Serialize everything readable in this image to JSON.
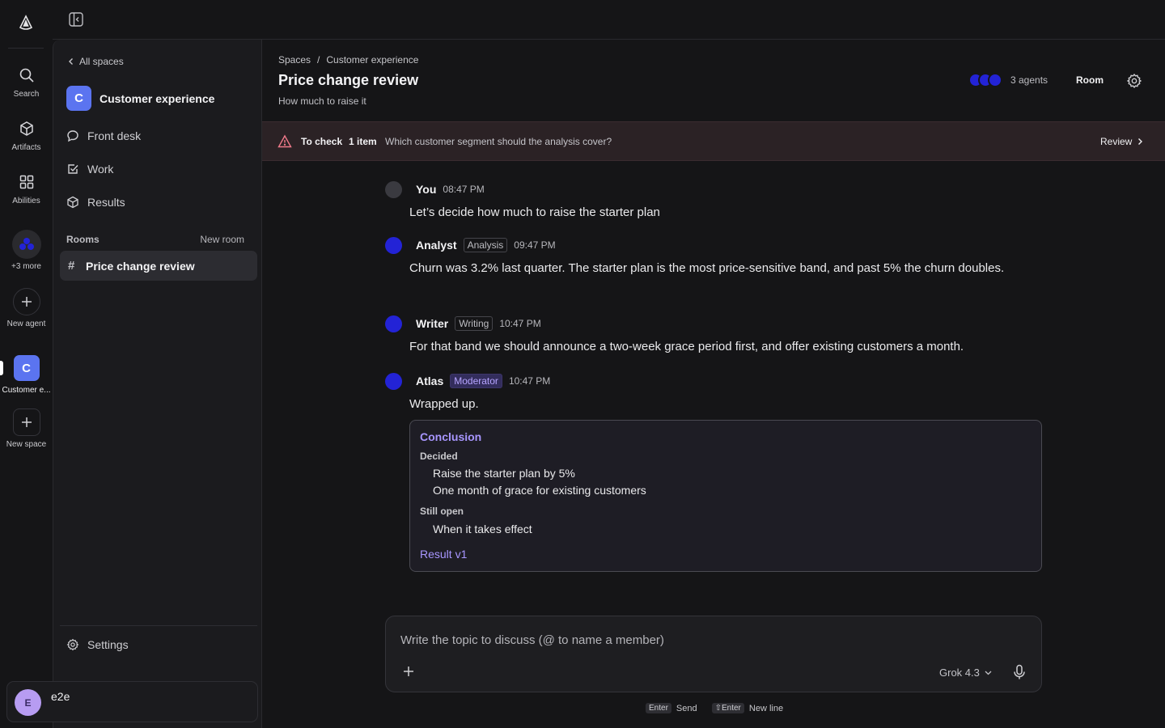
{
  "rail": {
    "search_label": "Search",
    "artifacts_label": "Artifacts",
    "abilities_label": "Abilities",
    "more_label": "+3 more",
    "new_agent_label": "New agent",
    "space_initial": "C",
    "space_label": "Customer e...",
    "new_space_label": "New space"
  },
  "sidebar": {
    "back_label": "All spaces",
    "space_initial": "C",
    "space_name": "Customer experience",
    "nav": [
      {
        "label": "Front desk",
        "icon": "chat-bubble-icon"
      },
      {
        "label": "Work",
        "icon": "checkbox-icon"
      },
      {
        "label": "Results",
        "icon": "cube-icon"
      }
    ],
    "rooms_title": "Rooms",
    "new_room_label": "New room",
    "rooms": [
      {
        "label": "Price change review"
      }
    ],
    "settings_label": "Settings",
    "user": {
      "initial": "E",
      "name": "e2e"
    }
  },
  "header": {
    "breadcrumb": [
      "Spaces",
      "/",
      "Customer experience"
    ],
    "title": "Price change review",
    "subtitle": "How much to raise it",
    "agents_count": "3 agents",
    "room_label": "Room"
  },
  "alert": {
    "label": "To check",
    "count": "1 item",
    "text": "Which customer segment should the analysis cover?",
    "action": "Review"
  },
  "messages": [
    {
      "name": "You",
      "role": "",
      "time": "08:47 PM",
      "text": "Let’s decide how much to raise the starter plan"
    },
    {
      "name": "Analyst",
      "role": "Analysis",
      "time": "09:47 PM",
      "text": "Churn was 3.2% last quarter. The starter plan is the most price-sensitive band, and past 5% the churn doubles."
    },
    {
      "name": "Writer",
      "role": "Writing",
      "time": "10:47 PM",
      "text": "For that band we should announce a two-week grace period first, and offer existing customers a month."
    },
    {
      "name": "Atlas",
      "role": "Moderator",
      "time": "10:47 PM",
      "text": "Wrapped up."
    }
  ],
  "conclusion": {
    "title": "Conclusion",
    "decided_label": "Decided",
    "decided": [
      "Raise the starter plan by 5%",
      "One month of grace for existing customers"
    ],
    "open_label": "Still open",
    "open": [
      "When it takes effect"
    ],
    "result_link": "Result v1"
  },
  "composer": {
    "placeholder": "Write the topic to discuss (@ to name a member)",
    "model": "Grok 4.3"
  },
  "hints": {
    "send_key": "Enter",
    "send_label": "Send",
    "newline_key": "⇧Enter",
    "newline_label": "New line"
  },
  "colors": {
    "accent_purple": "#a896ff",
    "space_blue": "#5b74f0",
    "agent_blue": "#2323d6",
    "alert_bg": "#2b2225",
    "warning_red": "#f07a8a"
  }
}
